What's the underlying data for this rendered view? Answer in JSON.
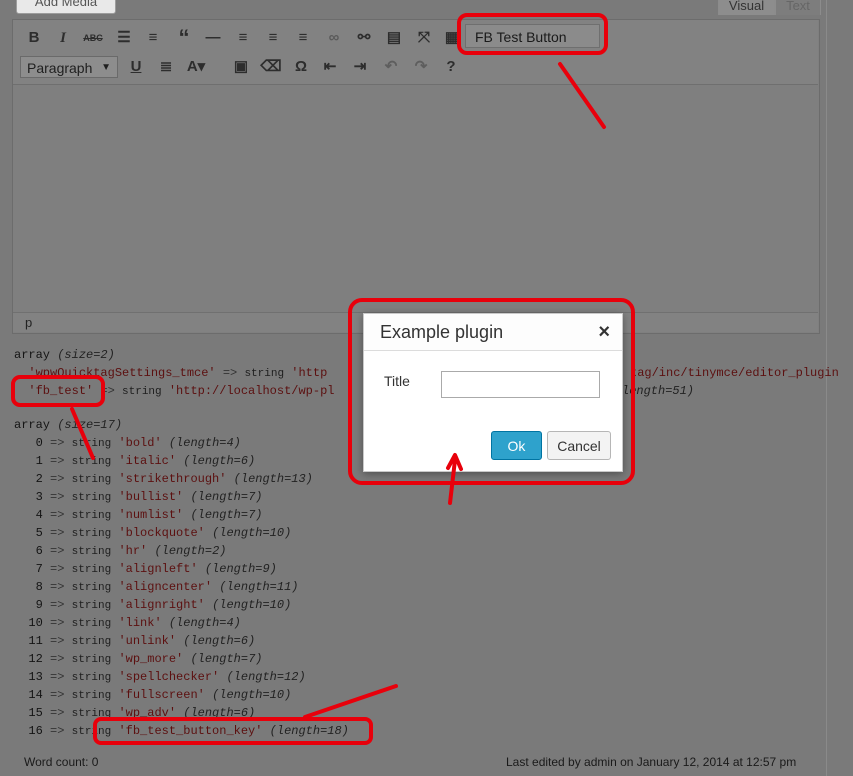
{
  "top": {
    "add_media": "Add Media",
    "tab_visual": "Visual",
    "tab_text": "Text"
  },
  "toolbar": {
    "row1_icons": [
      "bold-icon",
      "italic-icon",
      "strikethrough-icon",
      "bullet-list-icon",
      "numbered-list-icon",
      "blockquote-icon",
      "horizontal-rule-icon",
      "align-left-icon",
      "align-center-icon",
      "align-right-icon",
      "link-icon",
      "unlink-icon",
      "read-more-icon",
      "fullscreen-icon",
      "toolbar-toggle-icon"
    ],
    "row2_icons": [
      "underline-icon",
      "justify-icon",
      "text-color-icon",
      "paste-text-icon",
      "clear-formatting-icon",
      "special-character-icon",
      "outdent-icon",
      "indent-icon",
      "undo-icon",
      "redo-icon",
      "help-icon"
    ],
    "format_select": "Paragraph",
    "fb_test_button": "FB Test Button"
  },
  "path": "p",
  "dump": {
    "a1_header": "array",
    "a1_size": "(size=2)",
    "a1_row1_key": "'wpwQuicktagSettings_tmce'",
    "a1_row1_val": "'http",
    "a1_row1_tail": "tag/inc/tinymce/editor_plugin",
    "a1_row2_key": "'fb_test'",
    "a1_row2_val": "'http://localhost/wp-pl",
    "a1_row2_tail": "length=51)",
    "a2_header": "array",
    "a2_size": "(size=17)",
    "rows": [
      {
        "i": "0",
        "v": "'bold'",
        "l": "(length=4)"
      },
      {
        "i": "1",
        "v": "'italic'",
        "l": "(length=6)"
      },
      {
        "i": "2",
        "v": "'strikethrough'",
        "l": "(length=13)"
      },
      {
        "i": "3",
        "v": "'bullist'",
        "l": "(length=7)"
      },
      {
        "i": "4",
        "v": "'numlist'",
        "l": "(length=7)"
      },
      {
        "i": "5",
        "v": "'blockquote'",
        "l": "(length=10)"
      },
      {
        "i": "6",
        "v": "'hr'",
        "l": "(length=2)"
      },
      {
        "i": "7",
        "v": "'alignleft'",
        "l": "(length=9)"
      },
      {
        "i": "8",
        "v": "'aligncenter'",
        "l": "(length=11)"
      },
      {
        "i": "9",
        "v": "'alignright'",
        "l": "(length=10)"
      },
      {
        "i": "10",
        "v": "'link'",
        "l": "(length=4)"
      },
      {
        "i": "11",
        "v": "'unlink'",
        "l": "(length=6)"
      },
      {
        "i": "12",
        "v": "'wp_more'",
        "l": "(length=7)"
      },
      {
        "i": "13",
        "v": "'spellchecker'",
        "l": "(length=12)"
      },
      {
        "i": "14",
        "v": "'fullscreen'",
        "l": "(length=10)"
      },
      {
        "i": "15",
        "v": "'wp_adv'",
        "l": "(length=6)"
      },
      {
        "i": "16",
        "v": "'fb_test_button_key'",
        "l": "(length=18)"
      }
    ],
    "arrow": "=>",
    "type": "string"
  },
  "footer": {
    "word_count": "Word count: 0",
    "last_edited": "Last edited by admin on January 12, 2014 at 12:57 pm"
  },
  "dialog": {
    "title": "Example plugin",
    "close": "×",
    "label": "Title",
    "input_value": "",
    "ok": "Ok",
    "cancel": "Cancel"
  },
  "colors": {
    "annotation": "#e8000b",
    "ok_button": "#2ea2cc",
    "overlay": "#7a7a7a"
  }
}
